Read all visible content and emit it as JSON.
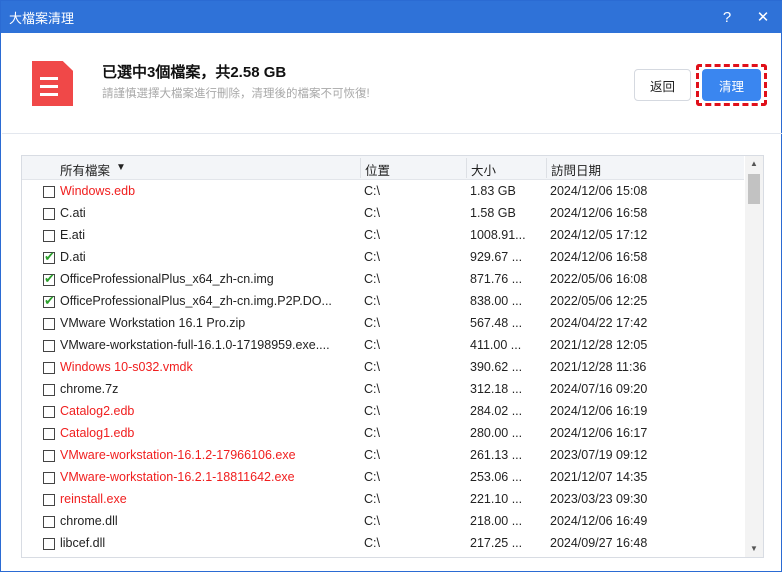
{
  "title": "大檔案清理",
  "help": "?",
  "close": "✕",
  "header": {
    "title": "已選中3個檔案，共2.58 GB",
    "subtitle": "請謹慎選擇大檔案進行刪除，清理後的檔案不可恢復!",
    "back": "返回",
    "clean": "清理"
  },
  "columns": {
    "name": "所有檔案",
    "sort": "▼",
    "location": "位置",
    "size": "大小",
    "date": "訪問日期"
  },
  "rows": [
    {
      "name": "Windows.edb",
      "loc": "C:\\",
      "size": "1.83 GB",
      "date": "2024/12/06 15:08",
      "checked": false,
      "red": true
    },
    {
      "name": "C.ati",
      "loc": "C:\\",
      "size": "1.58 GB",
      "date": "2024/12/06 16:58",
      "checked": false,
      "red": false
    },
    {
      "name": "E.ati",
      "loc": "C:\\",
      "size": "1008.91...",
      "date": "2024/12/05 17:12",
      "checked": false,
      "red": false
    },
    {
      "name": "D.ati",
      "loc": "C:\\",
      "size": "929.67 ...",
      "date": "2024/12/06 16:58",
      "checked": true,
      "red": false
    },
    {
      "name": "OfficeProfessionalPlus_x64_zh-cn.img",
      "loc": "C:\\",
      "size": "871.76 ...",
      "date": "2022/05/06 16:08",
      "checked": true,
      "red": false
    },
    {
      "name": "OfficeProfessionalPlus_x64_zh-cn.img.P2P.DO...",
      "loc": "C:\\",
      "size": "838.00 ...",
      "date": "2022/05/06 12:25",
      "checked": true,
      "red": false
    },
    {
      "name": "VMware Workstation 16.1 Pro.zip",
      "loc": "C:\\",
      "size": "567.48 ...",
      "date": "2024/04/22 17:42",
      "checked": false,
      "red": false
    },
    {
      "name": "VMware-workstation-full-16.1.0-17198959.exe....",
      "loc": "C:\\",
      "size": "411.00 ...",
      "date": "2021/12/28 12:05",
      "checked": false,
      "red": false
    },
    {
      "name": "Windows 10-s032.vmdk",
      "loc": "C:\\",
      "size": "390.62 ...",
      "date": "2021/12/28 11:36",
      "checked": false,
      "red": true
    },
    {
      "name": "chrome.7z",
      "loc": "C:\\",
      "size": "312.18 ...",
      "date": "2024/07/16 09:20",
      "checked": false,
      "red": false
    },
    {
      "name": "Catalog2.edb",
      "loc": "C:\\",
      "size": "284.02 ...",
      "date": "2024/12/06 16:19",
      "checked": false,
      "red": true
    },
    {
      "name": "Catalog1.edb",
      "loc": "C:\\",
      "size": "280.00 ...",
      "date": "2024/12/06 16:17",
      "checked": false,
      "red": true
    },
    {
      "name": "VMware-workstation-16.1.2-17966106.exe",
      "loc": "C:\\",
      "size": "261.13 ...",
      "date": "2023/07/19 09:12",
      "checked": false,
      "red": true
    },
    {
      "name": "VMware-workstation-16.2.1-18811642.exe",
      "loc": "C:\\",
      "size": "253.06 ...",
      "date": "2021/12/07 14:35",
      "checked": false,
      "red": true
    },
    {
      "name": "reinstall.exe",
      "loc": "C:\\",
      "size": "221.10 ...",
      "date": "2023/03/23 09:30",
      "checked": false,
      "red": true
    },
    {
      "name": "chrome.dll",
      "loc": "C:\\",
      "size": "218.00 ...",
      "date": "2024/12/06 16:49",
      "checked": false,
      "red": false
    },
    {
      "name": "libcef.dll",
      "loc": "C:\\",
      "size": "217.25 ...",
      "date": "2024/09/27 16:48",
      "checked": false,
      "red": false
    }
  ]
}
